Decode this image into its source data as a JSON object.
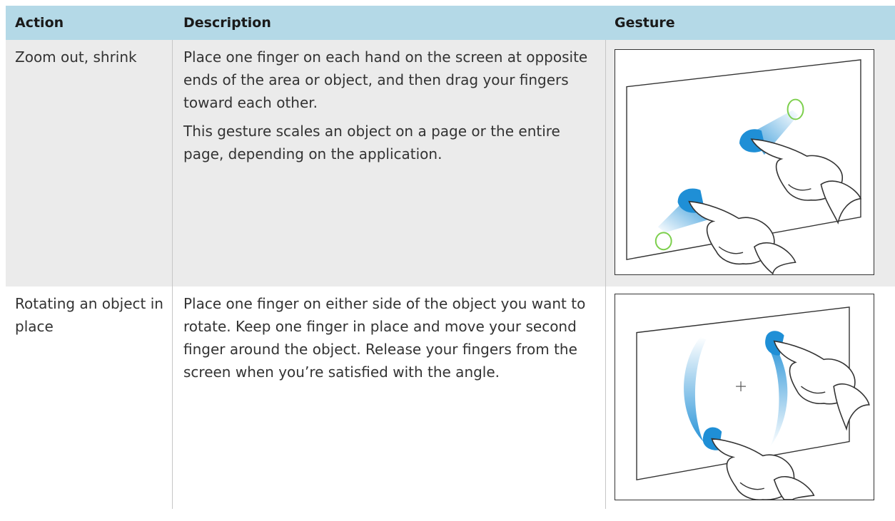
{
  "table": {
    "headers": {
      "action": "Action",
      "description": "Description",
      "gesture": "Gesture"
    },
    "rows": [
      {
        "action": "Zoom out, shrink",
        "description": [
          "Place one finger on each hand on the screen at opposite ends of the area or object, and then drag your fingers toward each other.",
          "This gesture scales an object on a page or the entire page, depending on the application."
        ],
        "gesture_icon": "zoom-out-gesture-illustration"
      },
      {
        "action": "Rotating an object in place",
        "description": [
          "Place one finger on either side of the object you want to rotate. Keep one finger in place and move your second finger around the object. Release your fingers from the screen when you’re satisfied with the angle."
        ],
        "gesture_icon": "rotate-gesture-illustration"
      }
    ]
  },
  "colors": {
    "header_bg": "#b4d9e7",
    "row_alt_bg": "#ebebeb",
    "touch_blue": "#1f8fd6",
    "ring_green": "#7ccf4c"
  }
}
